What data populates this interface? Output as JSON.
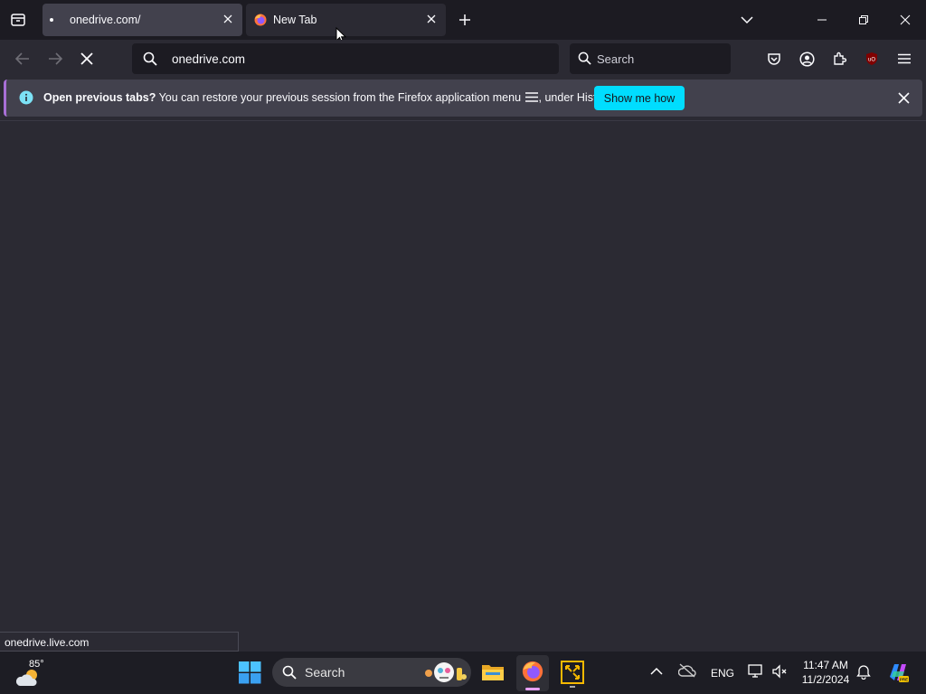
{
  "tabs": [
    {
      "title": "onedrive.com/",
      "close_icon": "close-icon"
    },
    {
      "title": "New Tab",
      "close_icon": "close-icon"
    }
  ],
  "navbar": {
    "url": "onedrive.com",
    "search_placeholder": "Search"
  },
  "notification": {
    "bold_text": "Open previous tabs?",
    "text_before_icon": " You can restore your previous session from the Firefox application menu",
    "text_after_icon": ", under History.",
    "button_label": "Show me how"
  },
  "status": {
    "link_preview": "onedrive.live.com"
  },
  "taskbar": {
    "weather_temp": "85°",
    "search_label": "Search",
    "language": "ENG",
    "time": "11:47 AM",
    "date": "11/2/2024"
  },
  "colors": {
    "accent": "#00ddff",
    "chrome_bg": "#1c1b22",
    "content_bg": "#2b2a33",
    "notification_bg": "#42414d"
  }
}
